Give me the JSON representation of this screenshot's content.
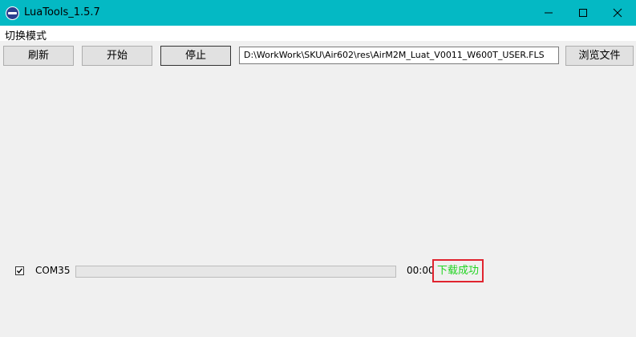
{
  "window": {
    "title": "LuaTools_1.5.7",
    "icon": "luatools-app-icon",
    "controls": [
      "minimize-icon",
      "maximize-icon",
      "close-icon"
    ]
  },
  "menu": {
    "items": [
      {
        "label": "切换模式"
      }
    ]
  },
  "toolbar": {
    "refresh_label": "刷新",
    "start_label": "开始",
    "stop_label": "停止",
    "file_path": "D:\\WorkWork\\SKU\\Air602\\res\\AirM2M_Luat_V0011_W600T_USER.FLS",
    "browse_label": "浏览文件"
  },
  "device": {
    "checked": true,
    "port": "COM35",
    "progress_percent": 0,
    "elapsed": "00:00",
    "status": "下载成功",
    "status_color": "#21d421",
    "highlight_color": "#e0242f"
  },
  "colors": {
    "titlebar": "#04b9c4",
    "background": "#f0f0f0"
  }
}
